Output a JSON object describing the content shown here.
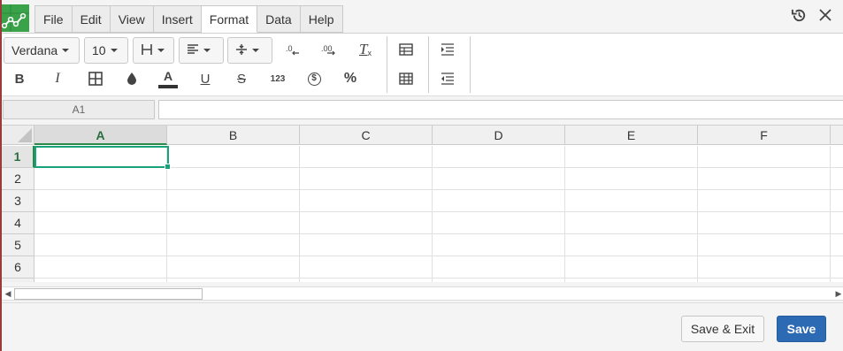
{
  "menubar": {
    "items": [
      {
        "label": "File",
        "active": false
      },
      {
        "label": "Edit",
        "active": false
      },
      {
        "label": "View",
        "active": false
      },
      {
        "label": "Insert",
        "active": false
      },
      {
        "label": "Format",
        "active": true
      },
      {
        "label": "Data",
        "active": false
      },
      {
        "label": "Help",
        "active": false
      }
    ]
  },
  "window": {
    "history_icon": "history-icon",
    "close_icon": "close-icon"
  },
  "toolbar": {
    "font_family": "Verdana",
    "font_size": "10",
    "bold": "B",
    "italic": "I",
    "text_color": "A",
    "underline": "U",
    "strikethrough": "S",
    "number_format": "123",
    "currency": "$",
    "percent": "%",
    "decrease_decimals": ".0",
    "increase_decimals": ".00",
    "clear_format": "T",
    "text_color_hex": "#333333"
  },
  "formula_bar": {
    "cell_ref": "A1",
    "value": ""
  },
  "grid": {
    "columns": [
      "A",
      "B",
      "C",
      "D",
      "E",
      "F"
    ],
    "rows": [
      "1",
      "2",
      "3",
      "4",
      "5",
      "6"
    ],
    "selected_column": "A",
    "selected_row": "1"
  },
  "footer": {
    "save_exit_label": "Save & Exit",
    "save_label": "Save"
  },
  "colors": {
    "accent": "#1aa37a",
    "primary_button": "#2d6ab4",
    "logo": "#3aa34a"
  }
}
